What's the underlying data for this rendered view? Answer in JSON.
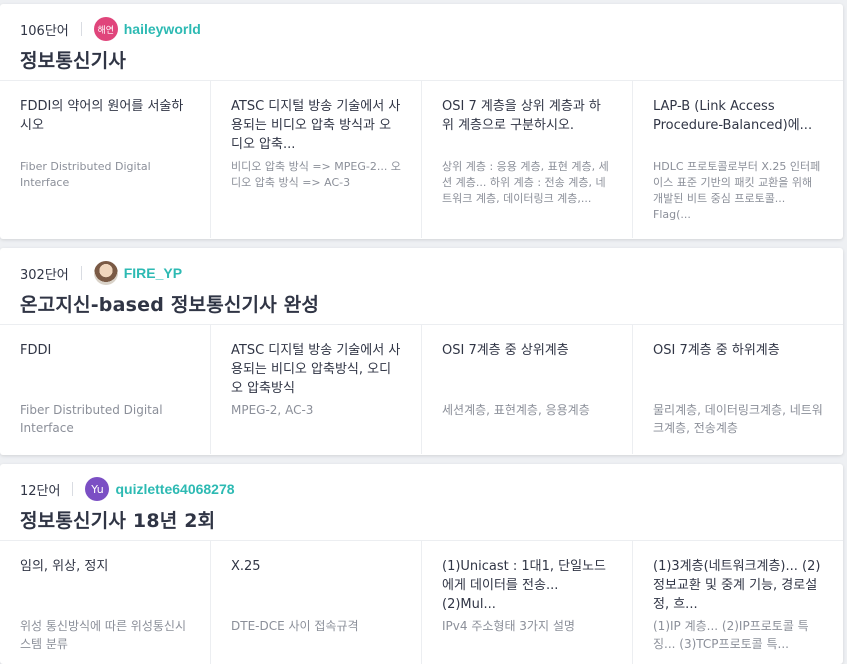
{
  "sets": [
    {
      "count": "106단어",
      "avatar_text": "해연",
      "avatar_color": "#e0457b",
      "username": "haileyworld",
      "title": "정보통신기사",
      "terms": [
        {
          "word": "FDDI의 약어의 원어를 서술하시오",
          "definition": "Fiber Distributed Digital Interface"
        },
        {
          "word": "ATSC 디지털 방송 기술에서 사용되는 비디오 압축 방식과 오디오 압축...",
          "definition": "비디오 압축 방식 => MPEG-2... 오디오 압축 방식 => AC-3"
        },
        {
          "word": "OSI 7 계층을 상위 계층과 하위 계층으로 구분하시오.",
          "definition": "상위 계층 : 응용 계층, 표현 계층, 세션 계층... 하위 계층 : 전송 계층, 네트워크 계층, 데이터링크 계층,..."
        },
        {
          "word": "LAP-B (Link Access Procedure-Balanced)에...",
          "definition": "HDLC 프로토콜로부터 X.25 인터페이스 표준 기반의 패킷 교환을 위해 개발된 비트 중심 프로토콜... Flag(..."
        }
      ]
    },
    {
      "count": "302단어",
      "avatar_text": "",
      "avatar_color": "#c8a27a",
      "username": "FIRE_YP",
      "title": "온고지신-based 정보통신기사 완성",
      "terms": [
        {
          "word": "FDDI",
          "definition": "Fiber Distributed Digital Interface"
        },
        {
          "word": "ATSC 디지털 방송 기술에서 사용되는 비디오 압축방식, 오디오 압축방식",
          "definition": "MPEG-2, AC-3"
        },
        {
          "word": "OSI 7계층 중 상위계층",
          "definition": "세션계층, 표현계층, 응용계층"
        },
        {
          "word": "OSI 7계층 중 하위계층",
          "definition": "물리계층, 데이터링크계층, 네트워크계층, 전송계층"
        }
      ]
    },
    {
      "count": "12단어",
      "avatar_text": "Yu",
      "avatar_color": "#7b4fc4",
      "username": "quizlette64068278",
      "title": "정보통신기사 18년 2회",
      "terms": [
        {
          "word": "임의, 위상, 정지",
          "definition": "위성 통신방식에 따른 위성통신시스템 분류"
        },
        {
          "word": "X.25",
          "definition": "DTE-DCE 사이 접속규격"
        },
        {
          "word": "(1)Unicast : 1대1, 단일노드에게 데이터를 전송... (2)Mul...",
          "definition": "IPv4 주소형태 3가지 설명"
        },
        {
          "word": "(1)3계층(네트워크계층)... (2)정보교환 및 중계 기능, 경로설정, 흐...",
          "definition": "(1)IP 계층... (2)IP프로토콜 특징... (3)TCP프로토콜 특..."
        }
      ]
    }
  ]
}
